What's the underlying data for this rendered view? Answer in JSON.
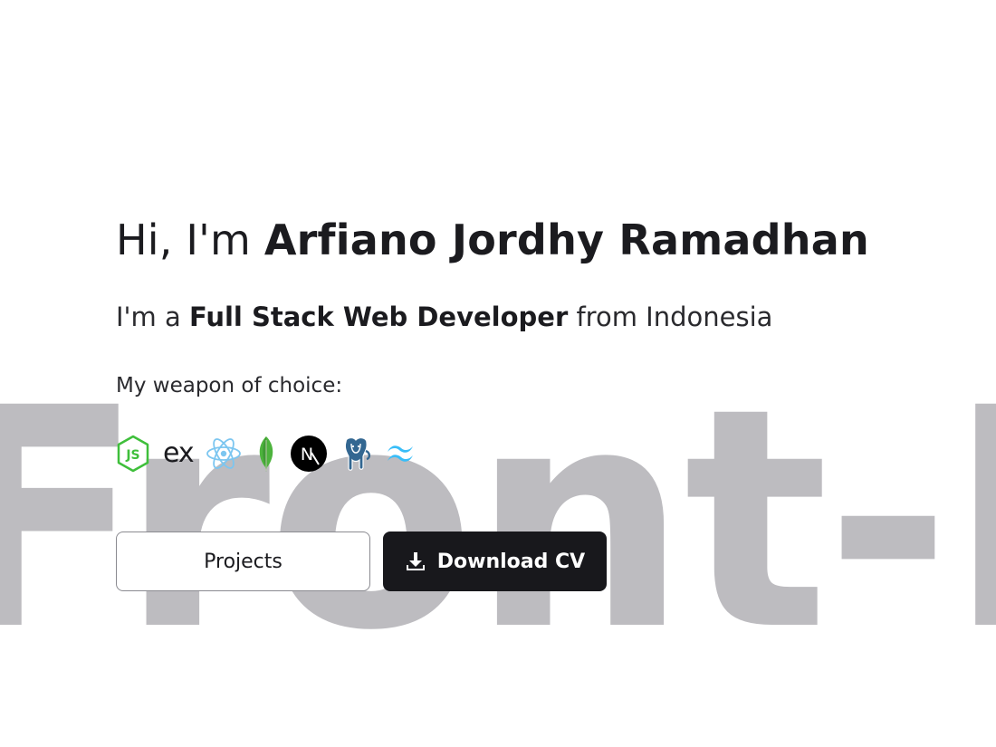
{
  "background_word": "Front-E",
  "hero": {
    "greeting_prefix": "Hi, I'm ",
    "name": "Arfiano Jordhy Ramadhan",
    "role_prefix": "I'm a ",
    "role": "Full Stack Web Developer",
    "role_suffix": " from Indonesia",
    "weapon_label": "My weapon of choice:"
  },
  "stack": [
    {
      "name": "nodejs-icon",
      "label": "JS",
      "color": "#3fbf3b"
    },
    {
      "name": "express-icon",
      "label": "ex",
      "color": "#1b1b1f"
    },
    {
      "name": "react-icon",
      "color": "#7cc6f0"
    },
    {
      "name": "mongodb-icon",
      "color": "#3fa037"
    },
    {
      "name": "nextjs-icon",
      "label": "N",
      "color": "#000000"
    },
    {
      "name": "postgresql-icon",
      "color": "#336791"
    },
    {
      "name": "tailwind-icon",
      "color": "#38bdf8"
    }
  ],
  "buttons": {
    "projects_label": "Projects",
    "download_label": "Download CV"
  },
  "colors": {
    "background": "#ffffff",
    "text": "#1b1b1f",
    "watermark": "#bdbcc0",
    "dark_button": "#18181c"
  }
}
